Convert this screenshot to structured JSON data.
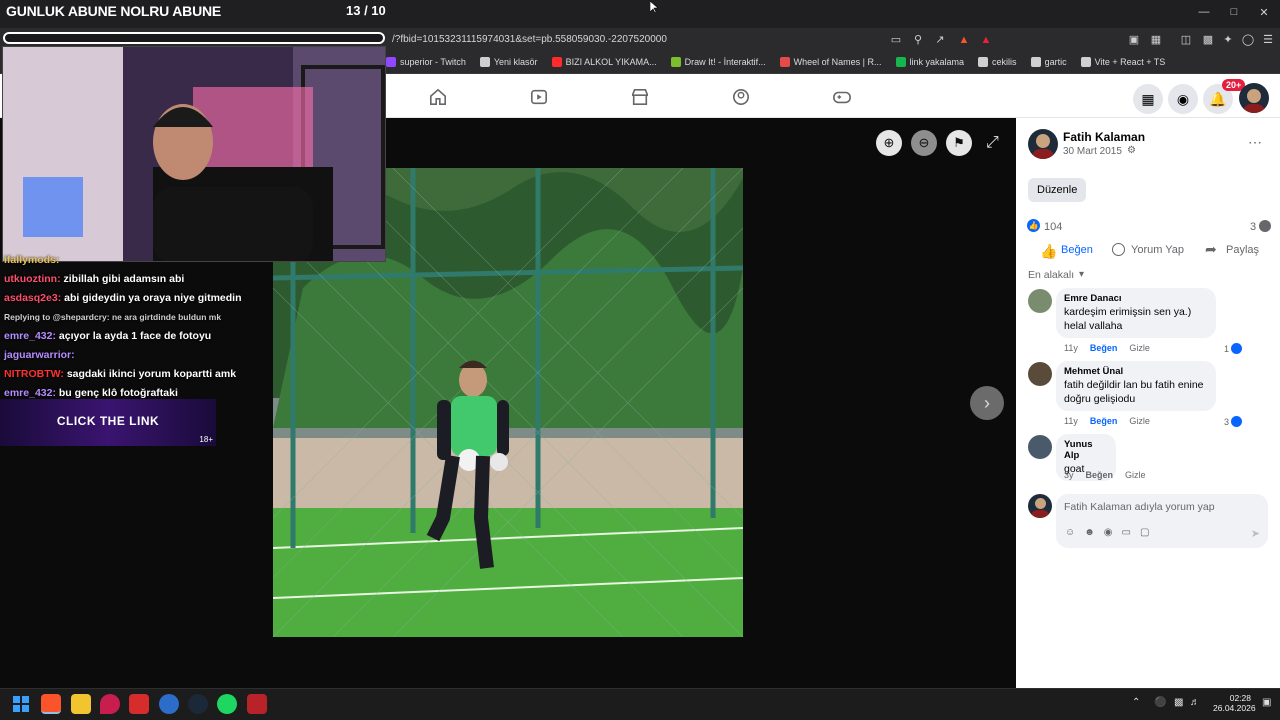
{
  "stream": {
    "title": "GUNLUK ABUNE NOLRU ABUNE",
    "counter": "13 / 10",
    "chat": [
      {
        "user": "ifallymods:",
        "msg": "",
        "color": "#e8c35a"
      },
      {
        "user": "utkuoztinn:",
        "msg": "zibillah gibi adamsın abi",
        "color": "#ff4d6d"
      },
      {
        "user": "asdasq2e3:",
        "msg": "abi gideydin ya oraya niye gitmedin",
        "color": "#ff4d6d"
      },
      {
        "user": "",
        "msg": "Replying to @shepardcry: ne ara girtdinde buldun mk",
        "color": "#cfcfcf"
      },
      {
        "user": "emre_432:",
        "msg": "açıyor la ayda 1 face de fotoyu",
        "color": "#b58cff"
      },
      {
        "user": "jaguarwarrior:",
        "msg": "",
        "color": "#b58cff"
      },
      {
        "user": "NITROBTW:",
        "msg": "sagdaki ikinci yorum kopartti amk",
        "color": "#ff3030"
      },
      {
        "user": "emre_432:",
        "msg": "bu genç klô fotoğraftaki",
        "color": "#b58cff"
      }
    ],
    "banner": "CLICK THE LINK",
    "banner_badge": "18+"
  },
  "browser": {
    "url": "/?fbid=10153231115974031&set=pb.558059030.-2207520000",
    "bookmarks": [
      {
        "label": "superior - Twitch",
        "color": "#9146ff"
      },
      {
        "label": "Yeni klasör",
        "color": "#cfcfcf"
      },
      {
        "label": "BIZI ALKOL YIKAMA...",
        "color": "#ff2a2a"
      },
      {
        "label": "Draw It! - İnteraktif...",
        "color": "#7bbf2e"
      },
      {
        "label": "Wheel of Names | R...",
        "color": "#e84a4a"
      },
      {
        "label": "link yakalama",
        "color": "#16b64f"
      },
      {
        "label": "cekilis",
        "color": "#cfcfcf"
      },
      {
        "label": "gartic",
        "color": "#cfcfcf"
      },
      {
        "label": "Vite + React + TS",
        "color": "#cfcfcf"
      }
    ],
    "notif_count": "20+"
  },
  "post": {
    "author": "Fatih Kalaman",
    "date": "30 Mart 2015",
    "edit_label": "Düzenle",
    "likes": "104",
    "comments_count": "3",
    "actions": {
      "like": "Beğen",
      "comment": "Yorum Yap",
      "share": "Paylaş"
    },
    "sort_label": "En alakalı",
    "comments": [
      {
        "name": "Emre Danacı",
        "text": "kardeşim erimişsin sen ya.) helal vallaha",
        "age": "11y",
        "like": "Beğen",
        "hide": "Gizle",
        "reactions": "1"
      },
      {
        "name": "Mehmet Ünal",
        "text": "fatih değildir lan bu fatih enine doğru gelişiodu",
        "age": "11y",
        "like": "Beğen",
        "hide": "Gizle",
        "reactions": "3"
      },
      {
        "name": "Yunus Alp",
        "text": "goat",
        "age": "3y",
        "like": "Beğen",
        "hide": "Gizle",
        "reactions": ""
      }
    ],
    "comment_placeholder": "Fatih Kalaman adıyla yorum yap"
  },
  "taskbar": {
    "time": "02:28",
    "date": "26.04.2026"
  },
  "colors": {
    "fb_blue": "#0866ff",
    "bubble": "#f0f2f5"
  }
}
